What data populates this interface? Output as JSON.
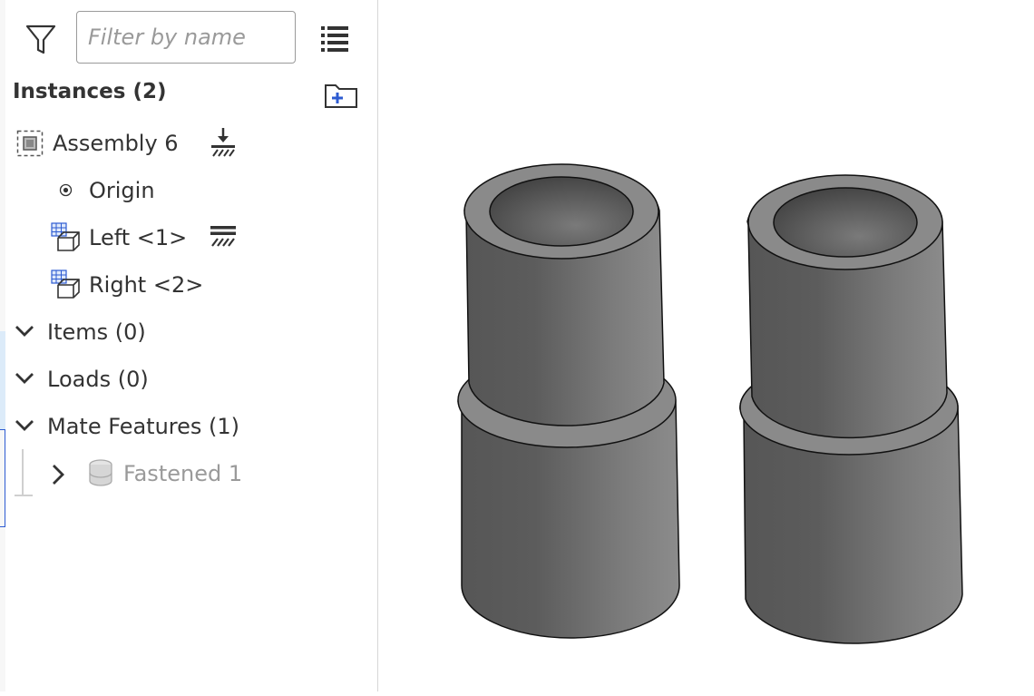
{
  "search": {
    "placeholder": "Filter by name"
  },
  "instances": {
    "heading": "Instances (2)",
    "items": [
      {
        "label": "Assembly 6"
      },
      {
        "label": "Origin"
      },
      {
        "label": "Left <1>"
      },
      {
        "label": "Right <2>"
      }
    ]
  },
  "sections": [
    {
      "label": "Items (0)"
    },
    {
      "label": "Loads (0)"
    },
    {
      "label": "Mate Features (1)"
    }
  ],
  "mate_features": [
    {
      "label": "Fastened 1"
    }
  ],
  "icons": [
    "filter-icon",
    "list-view-icon",
    "new-folder-icon",
    "assembly-icon",
    "fix-icon",
    "origin-icon",
    "part-instance-icon",
    "fixed-indicator-icon",
    "chevron-down-icon",
    "chevron-right-icon",
    "fastened-mate-icon"
  ],
  "colors": {
    "part_gray": "#6e6e6e",
    "accent_blue": "#2d5bd1",
    "selection": "#dcebf9"
  }
}
